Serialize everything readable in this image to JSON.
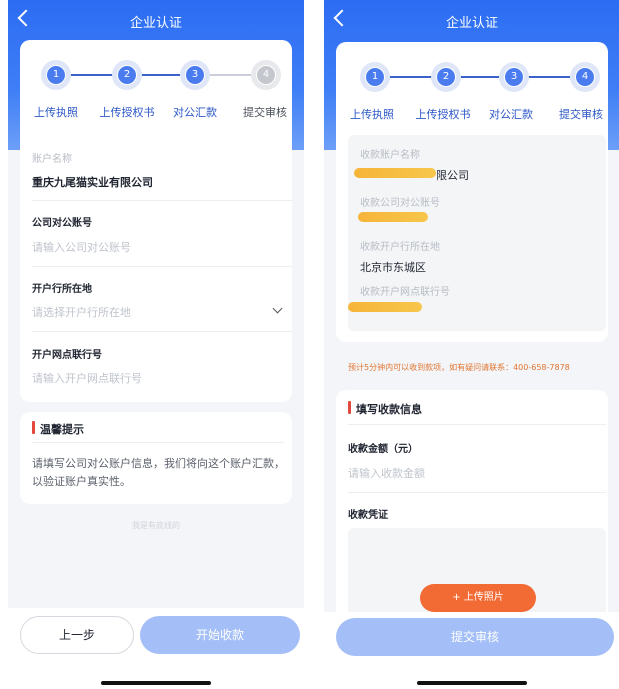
{
  "left": {
    "header_title": "企业认证",
    "steps": [
      {
        "num": "1",
        "label": "上传执照",
        "active": true
      },
      {
        "num": "2",
        "label": "上传授权书",
        "active": true
      },
      {
        "num": "3",
        "label": "对公汇款",
        "active": true
      },
      {
        "num": "4",
        "label": "提交审核",
        "active": false
      }
    ],
    "account_name_label": "账户名称",
    "account_name_value": "重庆九尾猫实业有限公司",
    "account_no_label": "公司对公账号",
    "account_no_placeholder": "请输入公司对公账号",
    "bank_location_label": "开户行所在地",
    "bank_location_placeholder": "请选择开户行所在地",
    "branch_no_label": "开户网点联行号",
    "branch_no_placeholder": "请输入开户网点联行号",
    "tips_title": "温馨提示",
    "tips_text": "请填写公司对公账户信息，我们将向这个账户汇款，以验证账户真实性。",
    "footer_hint": "我是有底线的",
    "prev_button": "上一步",
    "start_button": "开始收款"
  },
  "right": {
    "header_title": "企业认证",
    "steps": [
      {
        "num": "1",
        "label": "上传执照",
        "active": true
      },
      {
        "num": "2",
        "label": "上传授权书",
        "active": true
      },
      {
        "num": "3",
        "label": "对公汇款",
        "active": true
      },
      {
        "num": "4",
        "label": "提交审核",
        "active": true
      }
    ],
    "recv_name_label": "收款账户名称",
    "recv_name_value_visible": "限公司",
    "recv_account_label": "收款公司对公账号",
    "recv_bank_label": "收款开户行所在地",
    "recv_bank_value": "北京市东城区",
    "recv_branch_label": "收款开户网点联行号",
    "notice": "预计5分钟内可以收到款项，如有疑问请联系：400-658-7878",
    "fill_title": "填写收款信息",
    "amount_label": "收款金额（元）",
    "amount_placeholder": "请输入收款金额",
    "voucher_label": "收款凭证",
    "upload_button": "+ 上传照片",
    "submit_button": "提交审核"
  },
  "colors": {
    "primary": "#3a6ff2",
    "primary_light": "#9fbcf7",
    "accent_orange": "#f26b35",
    "notice_text": "#e2752f",
    "tips_bar": "#e2483d"
  }
}
